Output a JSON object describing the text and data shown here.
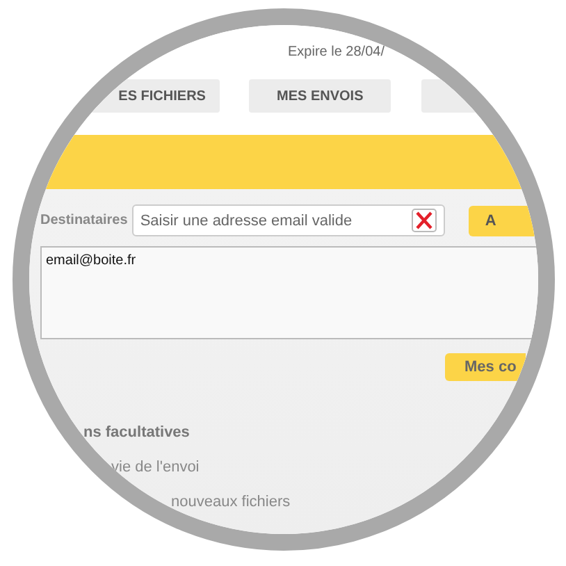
{
  "header": {
    "expiry": "Expire le 28/04/"
  },
  "tabs": [
    {
      "label": "ES FICHIERS",
      "selected": false
    },
    {
      "label": "MES ENVOIS",
      "selected": false
    },
    {
      "selected": false
    }
  ],
  "recipients": {
    "label": "Destinataires",
    "placeholder": "Saisir une adresse email valide",
    "add_button": "A",
    "list": [
      "email@boite.fr"
    ],
    "contacts_button": "Mes co"
  },
  "options": {
    "title": "ns facultatives",
    "items": [
      "vie de l'envoi",
      "nouveaux fichiers"
    ]
  }
}
